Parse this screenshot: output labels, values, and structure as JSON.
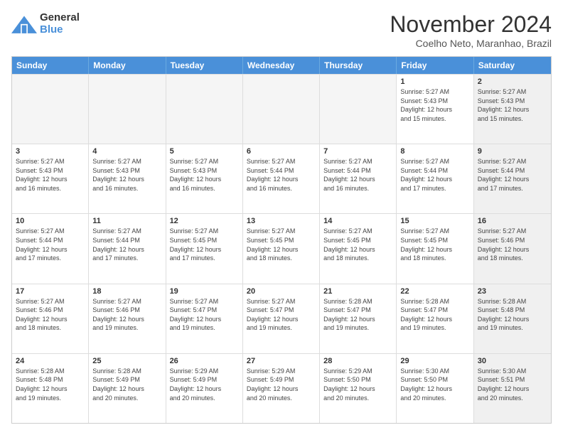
{
  "header": {
    "logo_line1": "General",
    "logo_line2": "Blue",
    "main_title": "November 2024",
    "subtitle": "Coelho Neto, Maranhao, Brazil"
  },
  "days_of_week": [
    "Sunday",
    "Monday",
    "Tuesday",
    "Wednesday",
    "Thursday",
    "Friday",
    "Saturday"
  ],
  "weeks": [
    [
      {
        "day": "",
        "info": "",
        "shaded": true
      },
      {
        "day": "",
        "info": "",
        "shaded": true
      },
      {
        "day": "",
        "info": "",
        "shaded": true
      },
      {
        "day": "",
        "info": "",
        "shaded": true
      },
      {
        "day": "",
        "info": "",
        "shaded": true
      },
      {
        "day": "1",
        "info": "Sunrise: 5:27 AM\nSunset: 5:43 PM\nDaylight: 12 hours\nand 15 minutes.",
        "shaded": false
      },
      {
        "day": "2",
        "info": "Sunrise: 5:27 AM\nSunset: 5:43 PM\nDaylight: 12 hours\nand 15 minutes.",
        "shaded": true
      }
    ],
    [
      {
        "day": "3",
        "info": "Sunrise: 5:27 AM\nSunset: 5:43 PM\nDaylight: 12 hours\nand 16 minutes.",
        "shaded": false
      },
      {
        "day": "4",
        "info": "Sunrise: 5:27 AM\nSunset: 5:43 PM\nDaylight: 12 hours\nand 16 minutes.",
        "shaded": false
      },
      {
        "day": "5",
        "info": "Sunrise: 5:27 AM\nSunset: 5:43 PM\nDaylight: 12 hours\nand 16 minutes.",
        "shaded": false
      },
      {
        "day": "6",
        "info": "Sunrise: 5:27 AM\nSunset: 5:44 PM\nDaylight: 12 hours\nand 16 minutes.",
        "shaded": false
      },
      {
        "day": "7",
        "info": "Sunrise: 5:27 AM\nSunset: 5:44 PM\nDaylight: 12 hours\nand 16 minutes.",
        "shaded": false
      },
      {
        "day": "8",
        "info": "Sunrise: 5:27 AM\nSunset: 5:44 PM\nDaylight: 12 hours\nand 17 minutes.",
        "shaded": false
      },
      {
        "day": "9",
        "info": "Sunrise: 5:27 AM\nSunset: 5:44 PM\nDaylight: 12 hours\nand 17 minutes.",
        "shaded": true
      }
    ],
    [
      {
        "day": "10",
        "info": "Sunrise: 5:27 AM\nSunset: 5:44 PM\nDaylight: 12 hours\nand 17 minutes.",
        "shaded": false
      },
      {
        "day": "11",
        "info": "Sunrise: 5:27 AM\nSunset: 5:44 PM\nDaylight: 12 hours\nand 17 minutes.",
        "shaded": false
      },
      {
        "day": "12",
        "info": "Sunrise: 5:27 AM\nSunset: 5:45 PM\nDaylight: 12 hours\nand 17 minutes.",
        "shaded": false
      },
      {
        "day": "13",
        "info": "Sunrise: 5:27 AM\nSunset: 5:45 PM\nDaylight: 12 hours\nand 18 minutes.",
        "shaded": false
      },
      {
        "day": "14",
        "info": "Sunrise: 5:27 AM\nSunset: 5:45 PM\nDaylight: 12 hours\nand 18 minutes.",
        "shaded": false
      },
      {
        "day": "15",
        "info": "Sunrise: 5:27 AM\nSunset: 5:45 PM\nDaylight: 12 hours\nand 18 minutes.",
        "shaded": false
      },
      {
        "day": "16",
        "info": "Sunrise: 5:27 AM\nSunset: 5:46 PM\nDaylight: 12 hours\nand 18 minutes.",
        "shaded": true
      }
    ],
    [
      {
        "day": "17",
        "info": "Sunrise: 5:27 AM\nSunset: 5:46 PM\nDaylight: 12 hours\nand 18 minutes.",
        "shaded": false
      },
      {
        "day": "18",
        "info": "Sunrise: 5:27 AM\nSunset: 5:46 PM\nDaylight: 12 hours\nand 19 minutes.",
        "shaded": false
      },
      {
        "day": "19",
        "info": "Sunrise: 5:27 AM\nSunset: 5:47 PM\nDaylight: 12 hours\nand 19 minutes.",
        "shaded": false
      },
      {
        "day": "20",
        "info": "Sunrise: 5:27 AM\nSunset: 5:47 PM\nDaylight: 12 hours\nand 19 minutes.",
        "shaded": false
      },
      {
        "day": "21",
        "info": "Sunrise: 5:28 AM\nSunset: 5:47 PM\nDaylight: 12 hours\nand 19 minutes.",
        "shaded": false
      },
      {
        "day": "22",
        "info": "Sunrise: 5:28 AM\nSunset: 5:47 PM\nDaylight: 12 hours\nand 19 minutes.",
        "shaded": false
      },
      {
        "day": "23",
        "info": "Sunrise: 5:28 AM\nSunset: 5:48 PM\nDaylight: 12 hours\nand 19 minutes.",
        "shaded": true
      }
    ],
    [
      {
        "day": "24",
        "info": "Sunrise: 5:28 AM\nSunset: 5:48 PM\nDaylight: 12 hours\nand 19 minutes.",
        "shaded": false
      },
      {
        "day": "25",
        "info": "Sunrise: 5:28 AM\nSunset: 5:49 PM\nDaylight: 12 hours\nand 20 minutes.",
        "shaded": false
      },
      {
        "day": "26",
        "info": "Sunrise: 5:29 AM\nSunset: 5:49 PM\nDaylight: 12 hours\nand 20 minutes.",
        "shaded": false
      },
      {
        "day": "27",
        "info": "Sunrise: 5:29 AM\nSunset: 5:49 PM\nDaylight: 12 hours\nand 20 minutes.",
        "shaded": false
      },
      {
        "day": "28",
        "info": "Sunrise: 5:29 AM\nSunset: 5:50 PM\nDaylight: 12 hours\nand 20 minutes.",
        "shaded": false
      },
      {
        "day": "29",
        "info": "Sunrise: 5:30 AM\nSunset: 5:50 PM\nDaylight: 12 hours\nand 20 minutes.",
        "shaded": false
      },
      {
        "day": "30",
        "info": "Sunrise: 5:30 AM\nSunset: 5:51 PM\nDaylight: 12 hours\nand 20 minutes.",
        "shaded": true
      }
    ]
  ]
}
